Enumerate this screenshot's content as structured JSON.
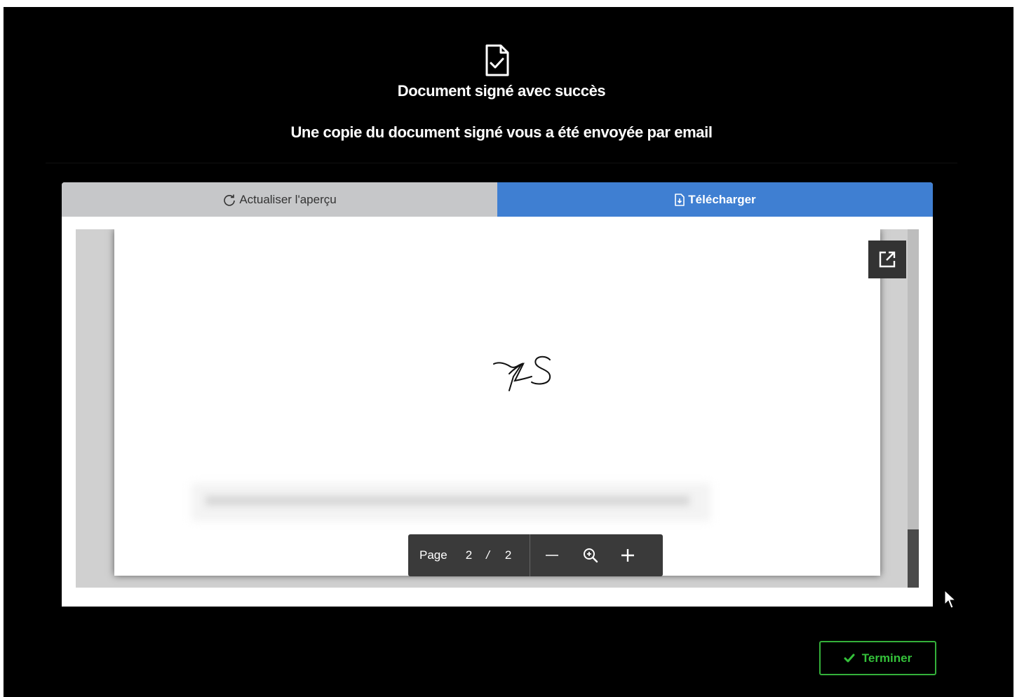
{
  "header": {
    "icon": "document-check-icon",
    "title": "Document signé avec succès",
    "subtitle": "Une copie du document signé vous a été envoyée par email"
  },
  "tabs": {
    "refresh_label": "Actualiser l'aperçu",
    "refresh_icon": "refresh-icon",
    "download_label": "Télécharger",
    "download_icon": "file-download-icon"
  },
  "viewer": {
    "popout_icon": "external-link-icon",
    "page_label": "Page",
    "current_page": "2",
    "separator": "/",
    "total_pages": "2",
    "zoom_out_icon": "minus-icon",
    "zoom_icon": "zoom-in-icon",
    "zoom_in_icon": "plus-icon"
  },
  "footer": {
    "finish_label": "Terminer",
    "finish_icon": "check-icon"
  },
  "colors": {
    "background": "#000000",
    "tab_active": "#3f7fd2",
    "tab_inactive": "#c6c7c9",
    "success": "#34c13a"
  }
}
